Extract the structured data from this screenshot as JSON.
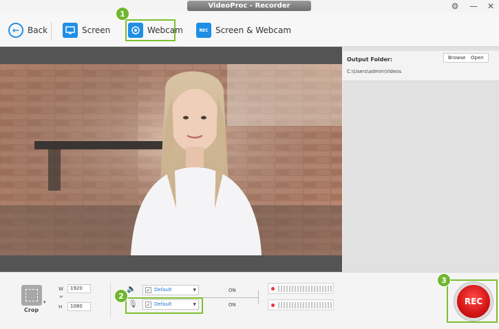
{
  "window": {
    "title": "VideoProc - Recorder",
    "controls": [
      "gear-icon",
      "minimize-icon",
      "close-icon"
    ]
  },
  "toolbar": {
    "back_label": "Back",
    "screen_label": "Screen",
    "webcam_label": "Webcam",
    "screen_webcam_label": "Screen & Webcam",
    "rec_icon_text": "REC"
  },
  "steps": {
    "one": "1",
    "two": "2",
    "three": "3"
  },
  "output": {
    "label": "Output Folder:",
    "path": "C:\\Users\\admin\\Videos",
    "browse_label": "Browse",
    "open_label": "Open"
  },
  "crop": {
    "label": "Crop",
    "w_label": "W",
    "h_label": "H",
    "width": "1920",
    "height": "1080"
  },
  "audio": {
    "speaker_device": "Default",
    "mic_device": "Default",
    "speaker_state": "ON",
    "mic_state": "ON"
  },
  "rec": {
    "label": "REC"
  },
  "colors": {
    "accent_blue": "#1f8ee5",
    "highlight_green": "#7cbf2e",
    "rec_red": "#d51414"
  }
}
